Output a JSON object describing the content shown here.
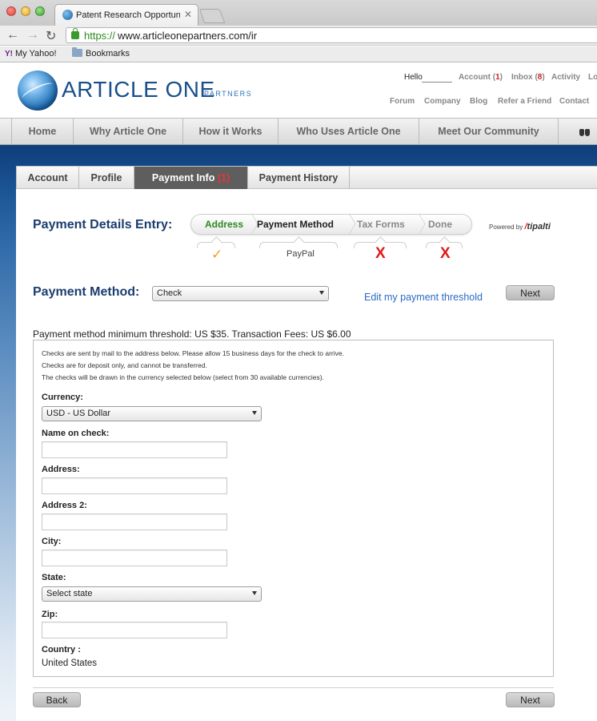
{
  "browser": {
    "tab_title": "Patent Research Opportuniti",
    "tab_close": "✕",
    "url_scheme": "https://",
    "url_rest": "www.articleonepartners.com/ir",
    "bookmarks": [
      "My Yahoo!",
      "Bookmarks"
    ]
  },
  "site": {
    "logo": "ARTICLE ONE",
    "logo_sub": "PARTNERS",
    "hello": "Hello",
    "top_links": {
      "account": "Account (",
      "account_count": "1",
      "account_close": ")",
      "inbox": "Inbox (",
      "inbox_count": "8",
      "inbox_close": ")",
      "activity": "Activity",
      "logout": "Lo"
    },
    "sub_links": [
      "Forum",
      "Company",
      "Blog",
      "Refer a Friend",
      "Contact"
    ],
    "main_nav": [
      "Home",
      "Why Article One",
      "How it Works",
      "Who Uses Article One",
      "Meet Our Community"
    ]
  },
  "account_tabs": {
    "account": "Account",
    "profile": "Profile",
    "payment_info": "Payment Info",
    "payment_info_badge": "(1)",
    "payment_history": "Payment History"
  },
  "payment_details": {
    "title": "Payment Details Entry:",
    "steps": [
      "Address",
      "Payment Method",
      "Tax Forms",
      "Done"
    ],
    "step_status": {
      "address": "✓",
      "payment_method": "PayPal",
      "tax_forms": "X",
      "done": "X"
    },
    "powered_by": "Powered by",
    "powered_brand": "tipalti",
    "powered_brand_mark": "/"
  },
  "payment_method": {
    "label": "Payment Method:",
    "selected": "Check",
    "edit_threshold_link": "Edit my payment threshold",
    "next": "Next",
    "threshold_text": "Payment method minimum threshold: US $35. Transaction Fees: US $6.00"
  },
  "check_form": {
    "notes": [
      "Checks are sent by mail to the address below. Please allow 15 business days for the check to arrive.",
      "Checks are for deposit only, and cannot be transferred.",
      "The checks will be drawn in the currency selected below (select from 30 available currencies)."
    ],
    "currency_label": "Currency:",
    "currency_value": "USD - US Dollar",
    "name_label": "Name on check:",
    "address_label": "Address:",
    "address2_label": "Address 2:",
    "city_label": "City:",
    "state_label": "State:",
    "state_value": "Select state",
    "zip_label": "Zip:",
    "country_label": "Country :",
    "country_value": "United States"
  },
  "footer_buttons": {
    "back": "Back",
    "next": "Next"
  }
}
